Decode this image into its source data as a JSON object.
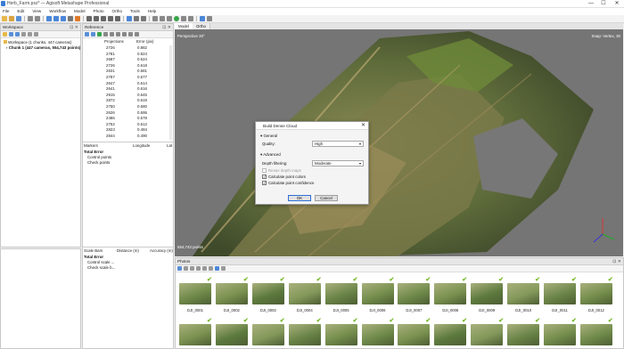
{
  "window": {
    "title": "Herb_Farm.psz* — Agisoft Metashape Professional",
    "minimize": "—",
    "maximize": "☐",
    "close": "✕"
  },
  "menu": [
    "File",
    "Edit",
    "View",
    "Workflow",
    "Model",
    "Photo",
    "Ortho",
    "Tools",
    "Help"
  ],
  "workspace": {
    "title": "Workspace",
    "root": "Workspace (1 chunks, 447 cameras)",
    "chunk": "Chunk 1 (447 cameras, 554,743 points)"
  },
  "reference": {
    "title": "Reference",
    "columns": [
      "Projections",
      "Error (pix)"
    ],
    "rows": [
      [
        "2726",
        "0.882"
      ],
      [
        "2781",
        "0.824"
      ],
      [
        "2687",
        "0.624"
      ],
      [
        "2726",
        "0.618"
      ],
      [
        "2631",
        "0.581"
      ],
      [
        "2787",
        "0.577"
      ],
      [
        "2647",
        "0.614"
      ],
      [
        "2641",
        "0.616"
      ],
      [
        "2915",
        "0.645"
      ],
      [
        "2872",
        "0.619"
      ],
      [
        "2750",
        "0.580"
      ],
      [
        "2626",
        "0.595"
      ],
      [
        "2486",
        "0.578"
      ],
      [
        "2752",
        "0.612"
      ],
      [
        "2823",
        "0.484"
      ],
      [
        "2844",
        "0.490"
      ]
    ],
    "markers_columns": [
      "Markers",
      "Longitude",
      "Lat"
    ],
    "markers_rows": [
      "Total Error",
      "Control points",
      "Check points"
    ],
    "scale_columns": [
      "Scale Bars",
      "Distance (m)",
      "Accuracy (m)"
    ],
    "scale_rows": [
      "Total Error",
      "Control scale ...",
      "Check scale b..."
    ]
  },
  "viewport": {
    "tabs": [
      "Model",
      "Ortho"
    ],
    "perspective": "Perspective 30°",
    "snap": "Snap: Vertex, 30",
    "points": "554,743 points"
  },
  "dialog": {
    "title": "Build Dense Cloud",
    "general": "General",
    "quality_label": "Quality:",
    "quality_value": "High",
    "advanced": "Advanced",
    "depth_label": "Depth filtering:",
    "depth_value": "Moderate",
    "reuse": "Reuse depth maps",
    "calc_colors": "Calculate point colors",
    "calc_confidence": "Calculate point confidence",
    "ok": "OK",
    "cancel": "Cancel"
  },
  "photos": {
    "title": "Photos",
    "labels": [
      "DJI_0001",
      "DJI_0002",
      "DJI_0003",
      "DJI_0004",
      "DJI_0005",
      "DJI_0006",
      "DJI_0007",
      "DJI_0008",
      "DJI_0009",
      "DJI_0010",
      "DJI_0011",
      "DJI_0012"
    ]
  },
  "colors": {
    "accent": "#2f6fd8",
    "check": "#76b82a"
  }
}
